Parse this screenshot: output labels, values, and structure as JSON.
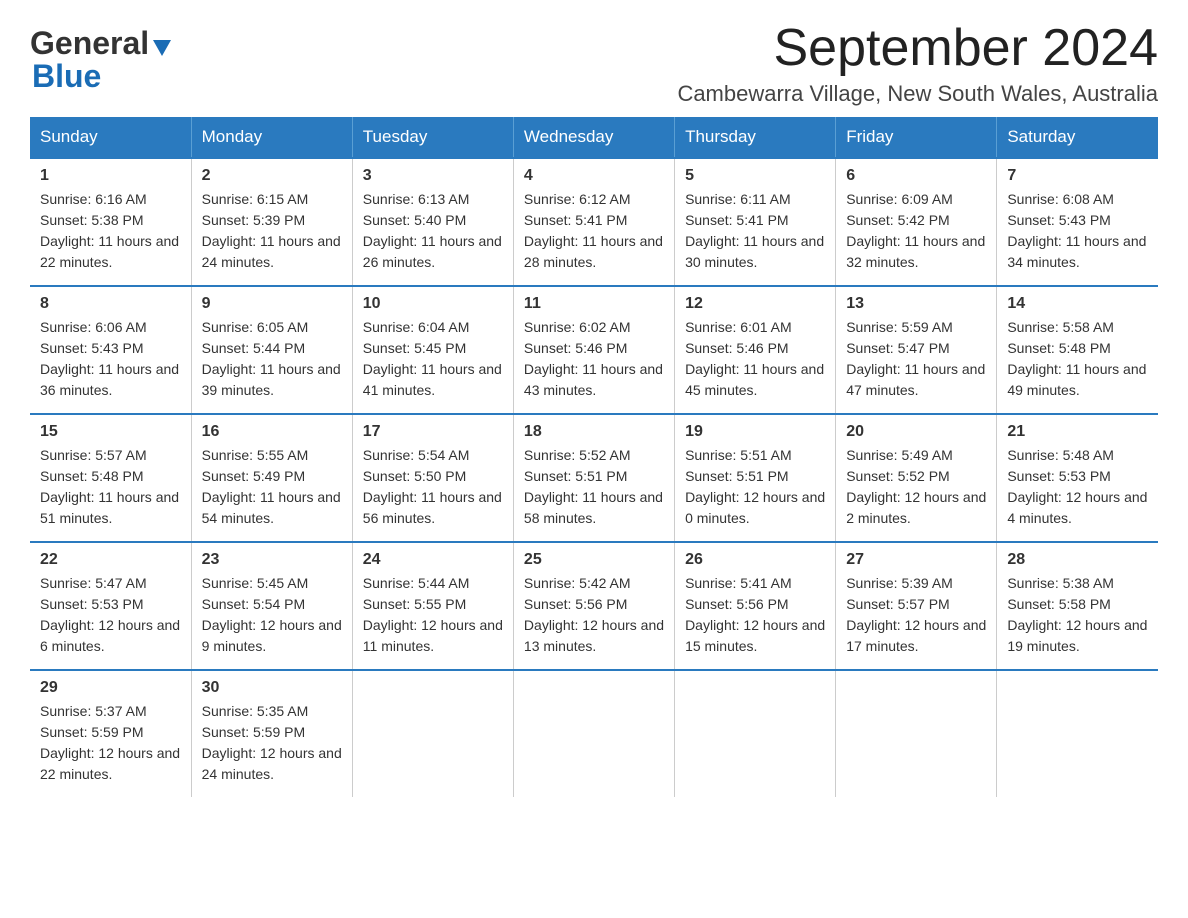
{
  "header": {
    "logo_general": "General",
    "logo_blue": "Blue",
    "month_title": "September 2024",
    "location": "Cambewarra Village, New South Wales, Australia"
  },
  "calendar": {
    "days_of_week": [
      "Sunday",
      "Monday",
      "Tuesday",
      "Wednesday",
      "Thursday",
      "Friday",
      "Saturday"
    ],
    "weeks": [
      [
        {
          "day": "1",
          "sunrise": "6:16 AM",
          "sunset": "5:38 PM",
          "daylight": "11 hours and 22 minutes."
        },
        {
          "day": "2",
          "sunrise": "6:15 AM",
          "sunset": "5:39 PM",
          "daylight": "11 hours and 24 minutes."
        },
        {
          "day": "3",
          "sunrise": "6:13 AM",
          "sunset": "5:40 PM",
          "daylight": "11 hours and 26 minutes."
        },
        {
          "day": "4",
          "sunrise": "6:12 AM",
          "sunset": "5:41 PM",
          "daylight": "11 hours and 28 minutes."
        },
        {
          "day": "5",
          "sunrise": "6:11 AM",
          "sunset": "5:41 PM",
          "daylight": "11 hours and 30 minutes."
        },
        {
          "day": "6",
          "sunrise": "6:09 AM",
          "sunset": "5:42 PM",
          "daylight": "11 hours and 32 minutes."
        },
        {
          "day": "7",
          "sunrise": "6:08 AM",
          "sunset": "5:43 PM",
          "daylight": "11 hours and 34 minutes."
        }
      ],
      [
        {
          "day": "8",
          "sunrise": "6:06 AM",
          "sunset": "5:43 PM",
          "daylight": "11 hours and 36 minutes."
        },
        {
          "day": "9",
          "sunrise": "6:05 AM",
          "sunset": "5:44 PM",
          "daylight": "11 hours and 39 minutes."
        },
        {
          "day": "10",
          "sunrise": "6:04 AM",
          "sunset": "5:45 PM",
          "daylight": "11 hours and 41 minutes."
        },
        {
          "day": "11",
          "sunrise": "6:02 AM",
          "sunset": "5:46 PM",
          "daylight": "11 hours and 43 minutes."
        },
        {
          "day": "12",
          "sunrise": "6:01 AM",
          "sunset": "5:46 PM",
          "daylight": "11 hours and 45 minutes."
        },
        {
          "day": "13",
          "sunrise": "5:59 AM",
          "sunset": "5:47 PM",
          "daylight": "11 hours and 47 minutes."
        },
        {
          "day": "14",
          "sunrise": "5:58 AM",
          "sunset": "5:48 PM",
          "daylight": "11 hours and 49 minutes."
        }
      ],
      [
        {
          "day": "15",
          "sunrise": "5:57 AM",
          "sunset": "5:48 PM",
          "daylight": "11 hours and 51 minutes."
        },
        {
          "day": "16",
          "sunrise": "5:55 AM",
          "sunset": "5:49 PM",
          "daylight": "11 hours and 54 minutes."
        },
        {
          "day": "17",
          "sunrise": "5:54 AM",
          "sunset": "5:50 PM",
          "daylight": "11 hours and 56 minutes."
        },
        {
          "day": "18",
          "sunrise": "5:52 AM",
          "sunset": "5:51 PM",
          "daylight": "11 hours and 58 minutes."
        },
        {
          "day": "19",
          "sunrise": "5:51 AM",
          "sunset": "5:51 PM",
          "daylight": "12 hours and 0 minutes."
        },
        {
          "day": "20",
          "sunrise": "5:49 AM",
          "sunset": "5:52 PM",
          "daylight": "12 hours and 2 minutes."
        },
        {
          "day": "21",
          "sunrise": "5:48 AM",
          "sunset": "5:53 PM",
          "daylight": "12 hours and 4 minutes."
        }
      ],
      [
        {
          "day": "22",
          "sunrise": "5:47 AM",
          "sunset": "5:53 PM",
          "daylight": "12 hours and 6 minutes."
        },
        {
          "day": "23",
          "sunrise": "5:45 AM",
          "sunset": "5:54 PM",
          "daylight": "12 hours and 9 minutes."
        },
        {
          "day": "24",
          "sunrise": "5:44 AM",
          "sunset": "5:55 PM",
          "daylight": "12 hours and 11 minutes."
        },
        {
          "day": "25",
          "sunrise": "5:42 AM",
          "sunset": "5:56 PM",
          "daylight": "12 hours and 13 minutes."
        },
        {
          "day": "26",
          "sunrise": "5:41 AM",
          "sunset": "5:56 PM",
          "daylight": "12 hours and 15 minutes."
        },
        {
          "day": "27",
          "sunrise": "5:39 AM",
          "sunset": "5:57 PM",
          "daylight": "12 hours and 17 minutes."
        },
        {
          "day": "28",
          "sunrise": "5:38 AM",
          "sunset": "5:58 PM",
          "daylight": "12 hours and 19 minutes."
        }
      ],
      [
        {
          "day": "29",
          "sunrise": "5:37 AM",
          "sunset": "5:59 PM",
          "daylight": "12 hours and 22 minutes."
        },
        {
          "day": "30",
          "sunrise": "5:35 AM",
          "sunset": "5:59 PM",
          "daylight": "12 hours and 24 minutes."
        },
        null,
        null,
        null,
        null,
        null
      ]
    ],
    "labels": {
      "sunrise": "Sunrise: ",
      "sunset": "Sunset: ",
      "daylight": "Daylight: "
    }
  }
}
